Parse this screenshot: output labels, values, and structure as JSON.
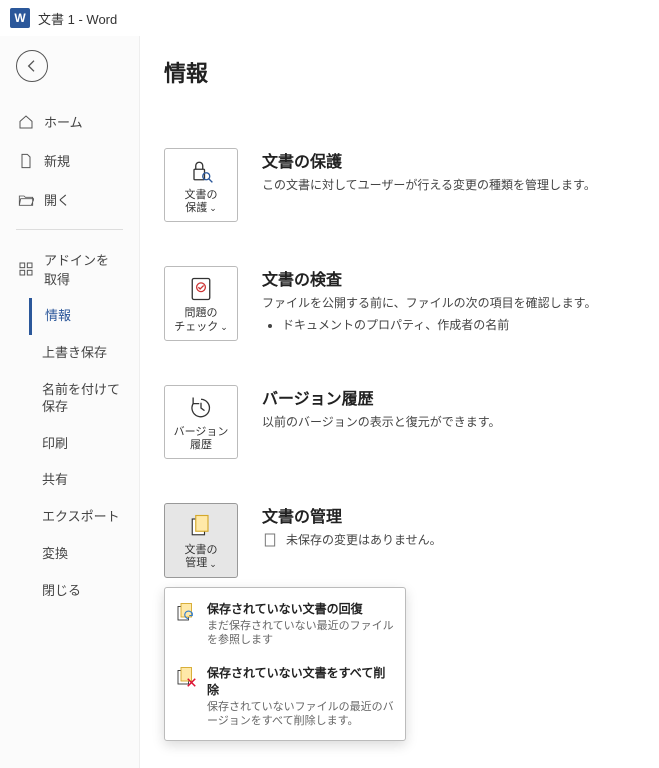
{
  "titlebar": {
    "doc_name": "文書 1",
    "sep": "  -  ",
    "app_name": "Word"
  },
  "nav": {
    "home": "ホーム",
    "new": "新規",
    "open": "開く",
    "addins": "アドインを取得",
    "sub": {
      "info": "情報",
      "save": "上書き保存",
      "saveas": "名前を付けて保存",
      "print": "印刷",
      "share": "共有",
      "export": "エクスポート",
      "transform": "変換",
      "close": "閉じる"
    }
  },
  "page_title": "情報",
  "sections": {
    "protect": {
      "tile_line1": "文書の",
      "tile_line2": "保護",
      "title": "文書の保護",
      "desc": "この文書に対してユーザーが行える変更の種類を管理します。"
    },
    "inspect": {
      "tile_line1": "問題の",
      "tile_line2": "チェック",
      "title": "文書の検査",
      "desc": "ファイルを公開する前に、ファイルの次の項目を確認します。",
      "bullet1": "ドキュメントのプロパティ、作成者の名前"
    },
    "history": {
      "tile_line1": "バージョン",
      "tile_line2": "履歴",
      "title": "バージョン履歴",
      "desc": "以前のバージョンの表示と復元ができます。"
    },
    "manage": {
      "tile_line1": "文書の",
      "tile_line2": "管理",
      "title": "文書の管理",
      "status": "未保存の変更はありません。",
      "menu": {
        "recover_title": "保存されていない文書の回復",
        "recover_desc": "まだ保存されていない最近のファイルを参照します",
        "delete_title": "保存されていない文書をすべて削除",
        "delete_desc": "保存されていないファイルの最近のバージョンをすべて削除します。"
      }
    }
  }
}
